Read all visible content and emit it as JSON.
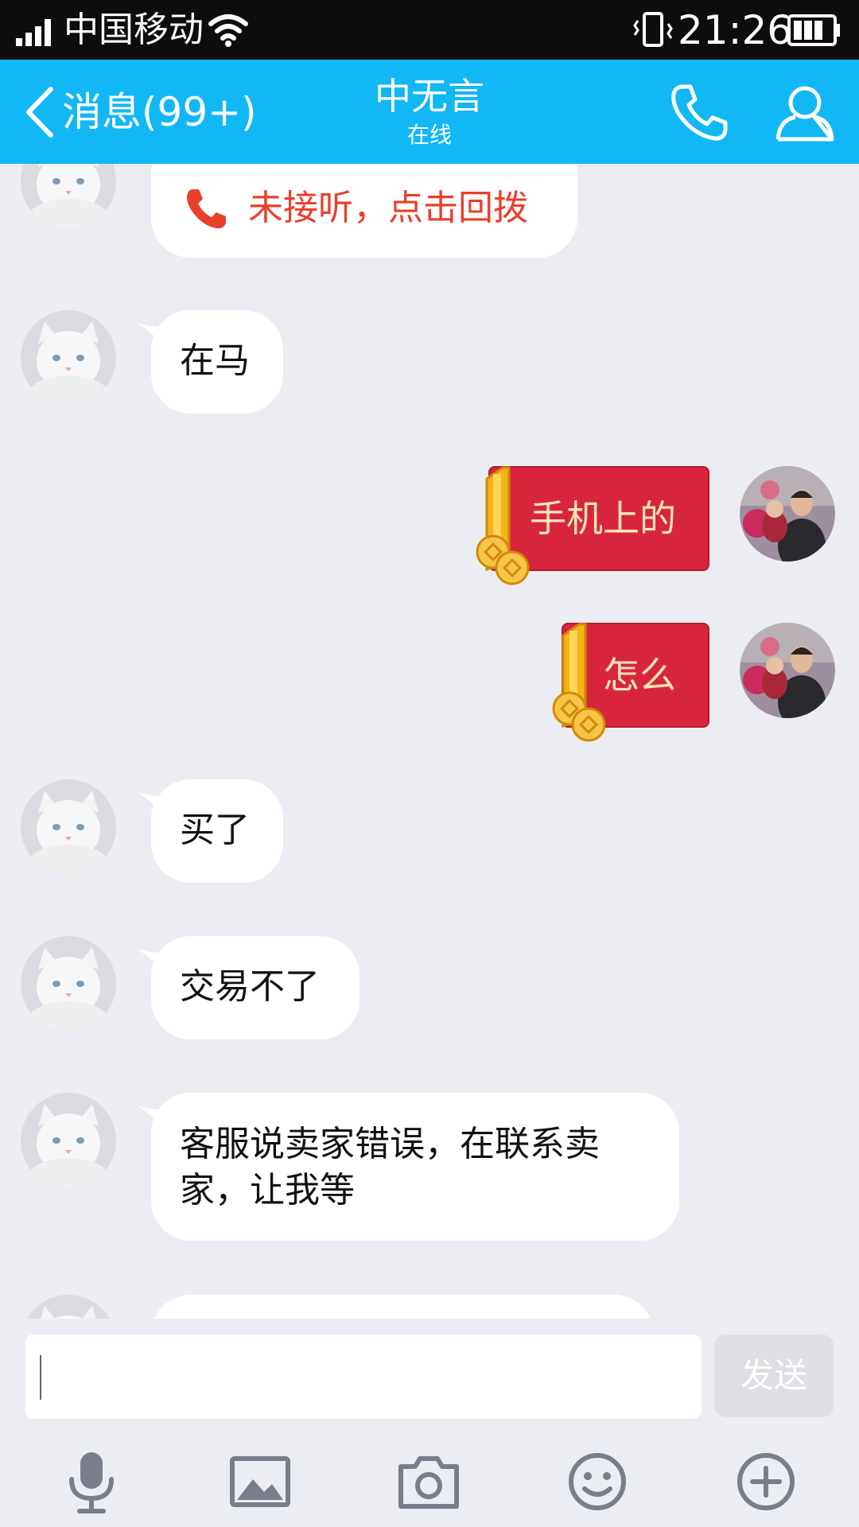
{
  "status_bar": {
    "carrier": "中国移动",
    "time": "21:26"
  },
  "header": {
    "back_label": "消息(99+)",
    "contact_name": "中无言",
    "presence": "在线"
  },
  "messages": [
    {
      "sender": "contact",
      "type": "missed_call",
      "text": "未接听，点击回拨"
    },
    {
      "sender": "contact",
      "type": "text",
      "text": "在马"
    },
    {
      "sender": "me",
      "type": "red_packet",
      "text": "手机上的"
    },
    {
      "sender": "me",
      "type": "red_packet",
      "text": "怎么"
    },
    {
      "sender": "contact",
      "type": "text",
      "text": "买了"
    },
    {
      "sender": "contact",
      "type": "text",
      "text": "交易不了"
    },
    {
      "sender": "contact",
      "type": "text",
      "text": "客服说卖家错误，在联系卖家，让我等"
    }
  ],
  "composer": {
    "input_value": "",
    "send_label": "发送"
  },
  "toolbar_icons": [
    "microphone-icon",
    "image-icon",
    "camera-icon",
    "emoji-icon",
    "plus-icon"
  ],
  "colors": {
    "title_bar": "#12b7f5",
    "background": "#ebedf2",
    "red_packet": "#d8253e",
    "red_packet_text": "#fde5b6",
    "missed_call": "#e8402b",
    "icon_gray": "#7a7e8a"
  }
}
